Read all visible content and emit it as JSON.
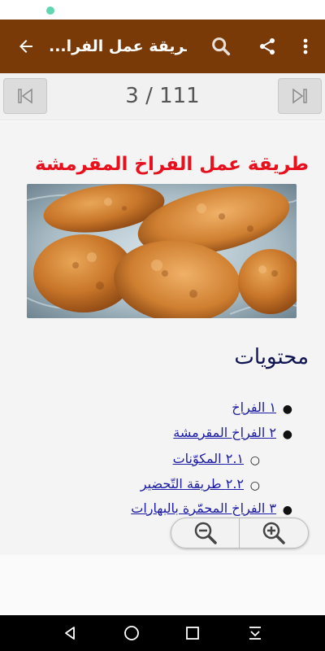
{
  "app_bar": {
    "title": "طريقة عمل الفرا...",
    "color": "#7a3a07",
    "icons": [
      "back-arrow-icon",
      "search-icon",
      "share-icon",
      "more-vert-icon"
    ]
  },
  "pager": {
    "indicator": "3 / 111",
    "icons": [
      "skip-previous-icon",
      "skip-next-icon"
    ]
  },
  "article": {
    "title": "طريقة عمل الفراخ المقرمشة",
    "title_color": "#e8101c",
    "image_description_icon": "fried-chicken-image",
    "contents_heading": "محتويات",
    "toc": [
      {
        "label": "١ الفراخ",
        "level": 1
      },
      {
        "label": "٢ الفراخ المقرمشة",
        "level": 1
      },
      {
        "label": "٢.١ المكوّنات",
        "level": 2
      },
      {
        "label": "٢.٢ طريقة التّحضير",
        "level": 2
      },
      {
        "label": "٣ الفراخ المحمّرة بالبهارات",
        "level": 1
      }
    ]
  },
  "zoom": {
    "icons": [
      "zoom-out-icon",
      "zoom-in-icon"
    ]
  },
  "nav_bar": {
    "icons": [
      "nav-back-icon",
      "nav-home-icon",
      "nav-recents-icon",
      "nav-notifications-icon"
    ]
  }
}
